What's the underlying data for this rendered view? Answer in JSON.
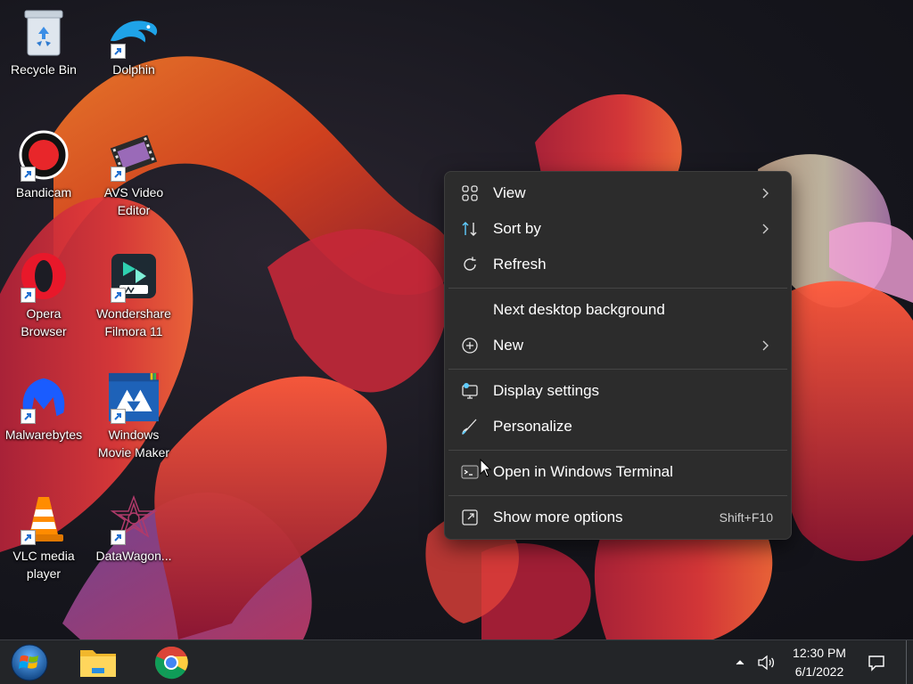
{
  "desktop": {
    "icons": [
      {
        "label": "Recycle Bin",
        "icon": "recycle-bin-icon",
        "shortcut": false
      },
      {
        "label": "Dolphin",
        "icon": "dolphin-icon",
        "shortcut": true
      },
      {
        "label": "Bandicam",
        "icon": "bandicam-icon",
        "shortcut": true
      },
      {
        "label": "AVS Video\nEditor",
        "icon": "avs-video-editor-icon",
        "shortcut": true
      },
      {
        "label": "Opera\nBrowser",
        "icon": "opera-icon",
        "shortcut": true
      },
      {
        "label": "Wondershare\nFilmora 11",
        "icon": "filmora-icon",
        "shortcut": true
      },
      {
        "label": "Malwarebytes",
        "icon": "malwarebytes-icon",
        "shortcut": true
      },
      {
        "label": "Windows\nMovie Maker",
        "icon": "movie-maker-icon",
        "shortcut": true
      },
      {
        "label": "VLC media\nplayer",
        "icon": "vlc-icon",
        "shortcut": true
      },
      {
        "label": "DataWagon...",
        "icon": "datawagon-icon",
        "shortcut": true
      }
    ]
  },
  "context_menu": {
    "items": [
      {
        "label": "View",
        "icon": "view-grid-icon",
        "submenu": true
      },
      {
        "label": "Sort by",
        "icon": "sort-icon",
        "submenu": true
      },
      {
        "label": "Refresh",
        "icon": "refresh-icon",
        "submenu": false
      },
      {
        "label": "Next desktop background",
        "icon": "",
        "submenu": false
      },
      {
        "label": "New",
        "icon": "new-plus-icon",
        "submenu": true
      },
      {
        "label": "Display settings",
        "icon": "display-settings-icon",
        "submenu": false
      },
      {
        "label": "Personalize",
        "icon": "personalize-brush-icon",
        "submenu": false
      },
      {
        "label": "Open in Windows Terminal",
        "icon": "terminal-icon",
        "submenu": false
      },
      {
        "label": "Show more options",
        "icon": "show-more-icon",
        "submenu": false,
        "shortcut": "Shift+F10"
      }
    ]
  },
  "taskbar": {
    "start": "windows-start-icon",
    "pinned": [
      {
        "name": "File Explorer",
        "icon": "file-explorer-icon"
      },
      {
        "name": "Google Chrome",
        "icon": "chrome-icon"
      }
    ],
    "tray": {
      "chevron": "show-hidden-icons-chevron",
      "volume": "volume-icon",
      "time": "12:30 PM",
      "date": "6/1/2022",
      "notifications": "action-center-icon"
    }
  },
  "colors": {
    "menu_bg": "#2c2c2c",
    "menu_separator": "#454545",
    "menu_text": "#ffffff",
    "accent_blue": "#60cdff",
    "taskbar_bg": "#232528"
  }
}
